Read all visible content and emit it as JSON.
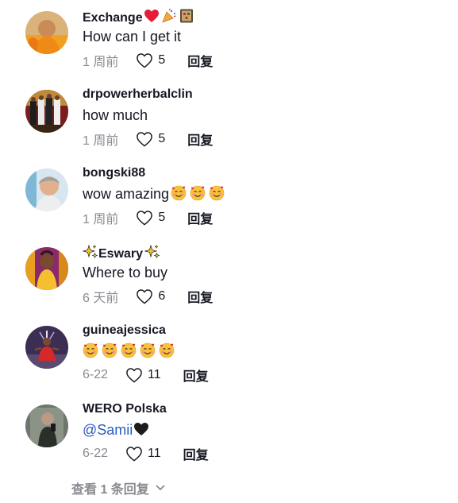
{
  "comments": [
    {
      "username": "Exchange",
      "username_emojis": [
        "red-heart-emoji",
        "party-popper-emoji",
        "mahjong-emoji"
      ],
      "text": "How can I get it",
      "time": "1 周前",
      "likes": "5",
      "reply_label": "回复",
      "avatar_icon": "monk-avatar"
    },
    {
      "username": "drpowerherbalclin",
      "text": "how much",
      "time": "1 周前",
      "likes": "5",
      "reply_label": "回复",
      "avatar_icon": "group-avatar"
    },
    {
      "username": "bongski88",
      "text": "wow amazing",
      "text_emojis": [
        "smiling-face-with-hearts-emoji",
        "smiling-face-with-hearts-emoji",
        "smiling-face-with-hearts-emoji"
      ],
      "time": "1 周前",
      "likes": "5",
      "reply_label": "回复",
      "avatar_icon": "person-avatar"
    },
    {
      "username": "Eswary",
      "username_emojis_before": [
        "sparkles-emoji"
      ],
      "username_emojis_after": [
        "sparkles-emoji"
      ],
      "text": "Where to buy",
      "time": "6 天前",
      "likes": "6",
      "reply_label": "回复",
      "avatar_icon": "woman-avatar"
    },
    {
      "username": "guineajessica",
      "text": "",
      "text_emojis": [
        "smiling-face-with-hearts-emoji",
        "smiling-face-with-hearts-emoji",
        "smiling-face-with-hearts-emoji",
        "smiling-face-with-hearts-emoji",
        "smiling-face-with-hearts-emoji"
      ],
      "time": "6-22",
      "likes": "11",
      "reply_label": "回复",
      "avatar_icon": "sculpture-avatar"
    },
    {
      "username": "WERO Polska",
      "text": "@Samii",
      "text_emojis": [
        "black-heart-emoji"
      ],
      "time": "6-22",
      "likes": "11",
      "reply_label": "回复",
      "avatar_icon": "mirror-selfie-avatar"
    }
  ],
  "view_replies": "查看 1 条回复",
  "colors": {
    "text": "#161823",
    "muted": "#8a8b91",
    "mention": "#2b5db9"
  }
}
